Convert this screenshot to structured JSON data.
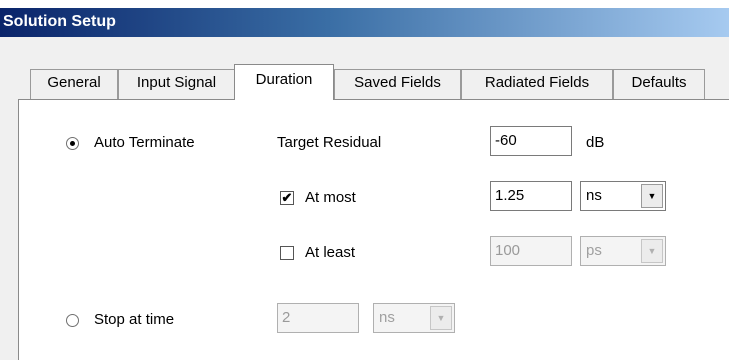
{
  "dialog": {
    "title": "Solution Setup"
  },
  "tabs": [
    {
      "label": "General"
    },
    {
      "label": "Input Signal"
    },
    {
      "label": "Duration"
    },
    {
      "label": "Saved Fields"
    },
    {
      "label": "Radiated Fields"
    },
    {
      "label": "Defaults"
    }
  ],
  "active_tab": "Duration",
  "auto_terminate": {
    "label": "Auto Terminate",
    "selected": true
  },
  "target_residual": {
    "label": "Target Residual",
    "value": "-60",
    "unit": "dB"
  },
  "at_most": {
    "label": "At most",
    "checked": true,
    "value": "1.25",
    "unit": "ns"
  },
  "at_least": {
    "label": "At least",
    "checked": false,
    "value": "100",
    "unit": "ps"
  },
  "stop_at_time": {
    "label": "Stop at time",
    "selected": false,
    "value": "2",
    "unit": "ns"
  }
}
